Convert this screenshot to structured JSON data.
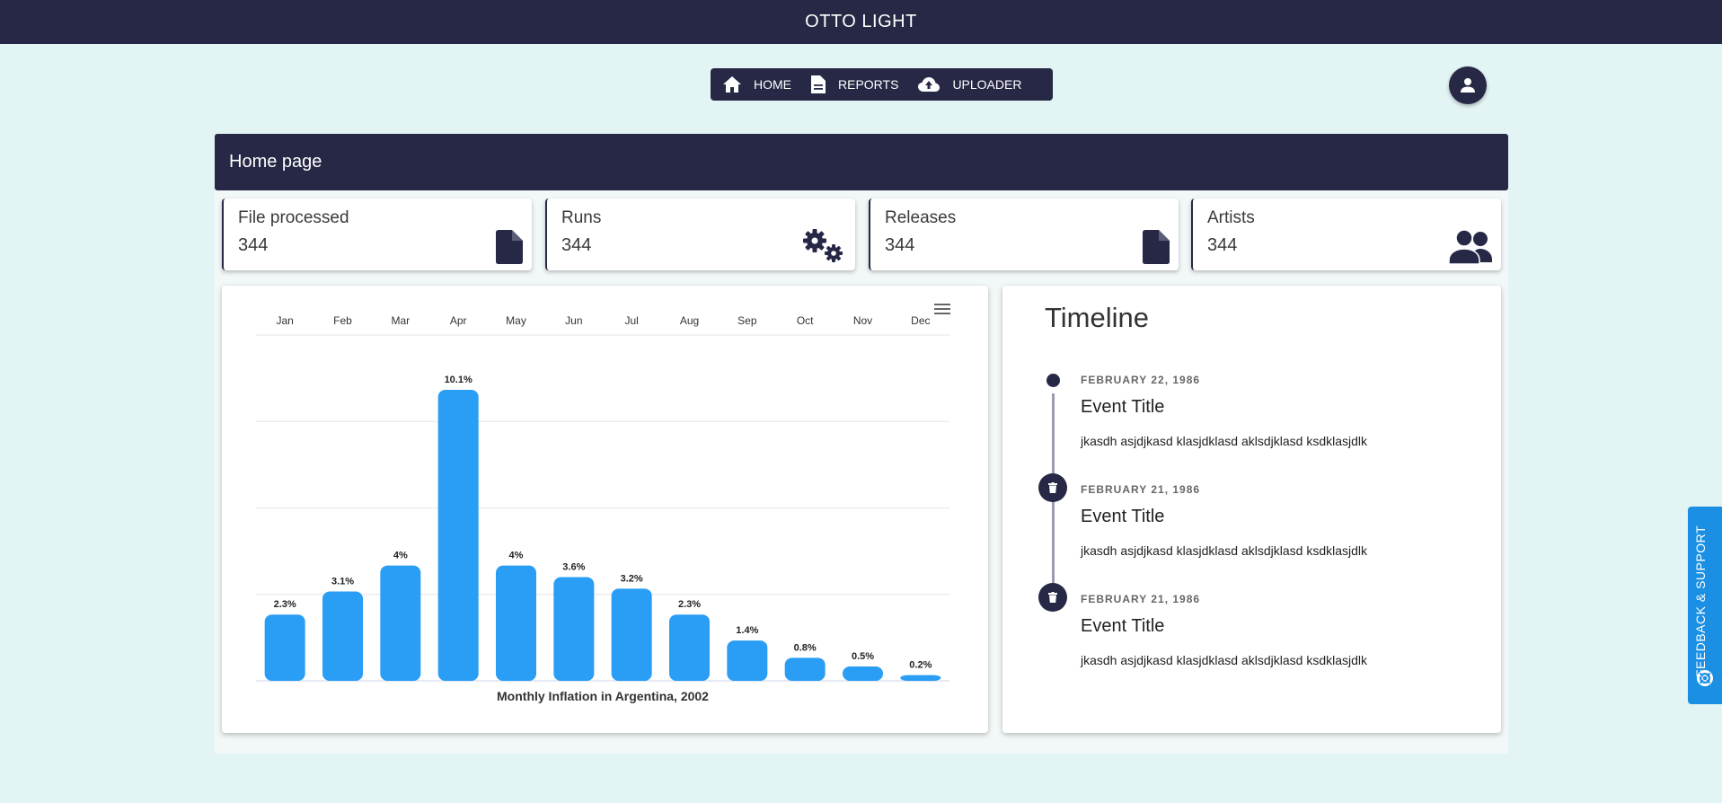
{
  "app": {
    "title": "OTTO LIGHT"
  },
  "nav": {
    "items": [
      {
        "label": "HOME",
        "icon": "home-icon"
      },
      {
        "label": "REPORTS",
        "icon": "document-icon"
      },
      {
        "label": "UPLOADER",
        "icon": "cloud-upload-icon"
      }
    ]
  },
  "page": {
    "title": "Home page"
  },
  "cards": [
    {
      "title": "File processed",
      "value": "344",
      "icon": "file-icon"
    },
    {
      "title": "Runs",
      "value": "344",
      "icon": "gears-icon"
    },
    {
      "title": "Releases",
      "value": "344",
      "icon": "file-icon"
    },
    {
      "title": "Artists",
      "value": "344",
      "icon": "users-icon"
    }
  ],
  "chart_data": {
    "type": "bar",
    "title": "Monthly Inflation in Argentina, 2002",
    "categories": [
      "Jan",
      "Feb",
      "Mar",
      "Apr",
      "May",
      "Jun",
      "Jul",
      "Aug",
      "Sep",
      "Oct",
      "Nov",
      "Dec"
    ],
    "values": [
      2.3,
      3.1,
      4,
      10.1,
      4,
      3.6,
      3.2,
      2.3,
      1.4,
      0.8,
      0.5,
      0.2
    ],
    "data_labels": [
      "2.3%",
      "3.1%",
      "4%",
      "10.1%",
      "4%",
      "3.6%",
      "3.2%",
      "2.3%",
      "1.4%",
      "0.8%",
      "0.5%",
      "0.2%"
    ],
    "xaxis_position": "top",
    "ylim": [
      0,
      12
    ],
    "grid": true,
    "bar_color": "#2a9df4"
  },
  "timeline": {
    "title": "Timeline",
    "events": [
      {
        "date": "FEBRUARY 22, 1986",
        "title": "Event Title",
        "description": "jkasdh asjdjkasd klasjdklasd aklsdjklasd ksdklasjdlk"
      },
      {
        "date": "FEBRUARY 21, 1986",
        "title": "Event Title",
        "description": "jkasdh asjdjkasd klasjdklasd aklsdjklasd ksdklasjdlk"
      },
      {
        "date": "FEBRUARY 21, 1986",
        "title": "Event Title",
        "description": "jkasdh asjdjkasd klasjdklasd aklsdjklasd ksdklasjdlk"
      }
    ]
  },
  "feedback": {
    "label": "FEEDBACK & SUPPORT",
    "icon": "lifebuoy-icon"
  },
  "colors": {
    "navy": "#262845",
    "background": "#e2f4f4",
    "accent": "#2a9df4",
    "feedback": "#1a8fe3"
  }
}
